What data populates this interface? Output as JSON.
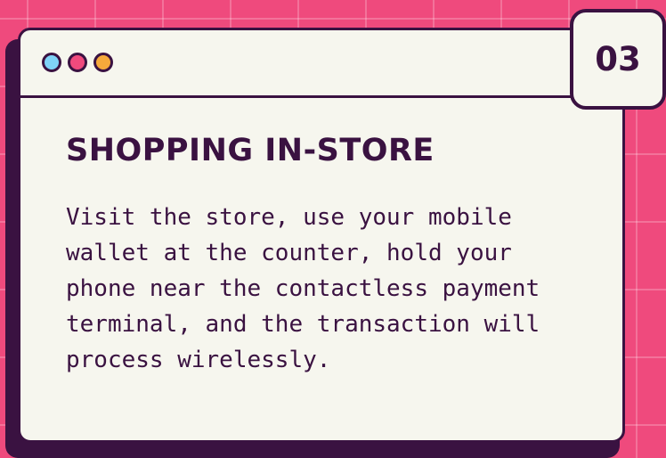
{
  "card": {
    "step_number": "03",
    "heading": "SHOPPING IN-STORE",
    "body": "Visit the store, use your mobile wallet at the counter, hold your phone near the contactless payment terminal, and the transaction will process wirelessly."
  },
  "window_controls": [
    {
      "name": "blue-dot",
      "color": "#7fd3f7"
    },
    {
      "name": "pink-dot",
      "color": "#ef4a7d"
    },
    {
      "name": "orange-dot",
      "color": "#f6a93b"
    }
  ],
  "colors": {
    "background": "#ef4a7d",
    "card": "#f6f6ee",
    "ink": "#3a1241"
  }
}
